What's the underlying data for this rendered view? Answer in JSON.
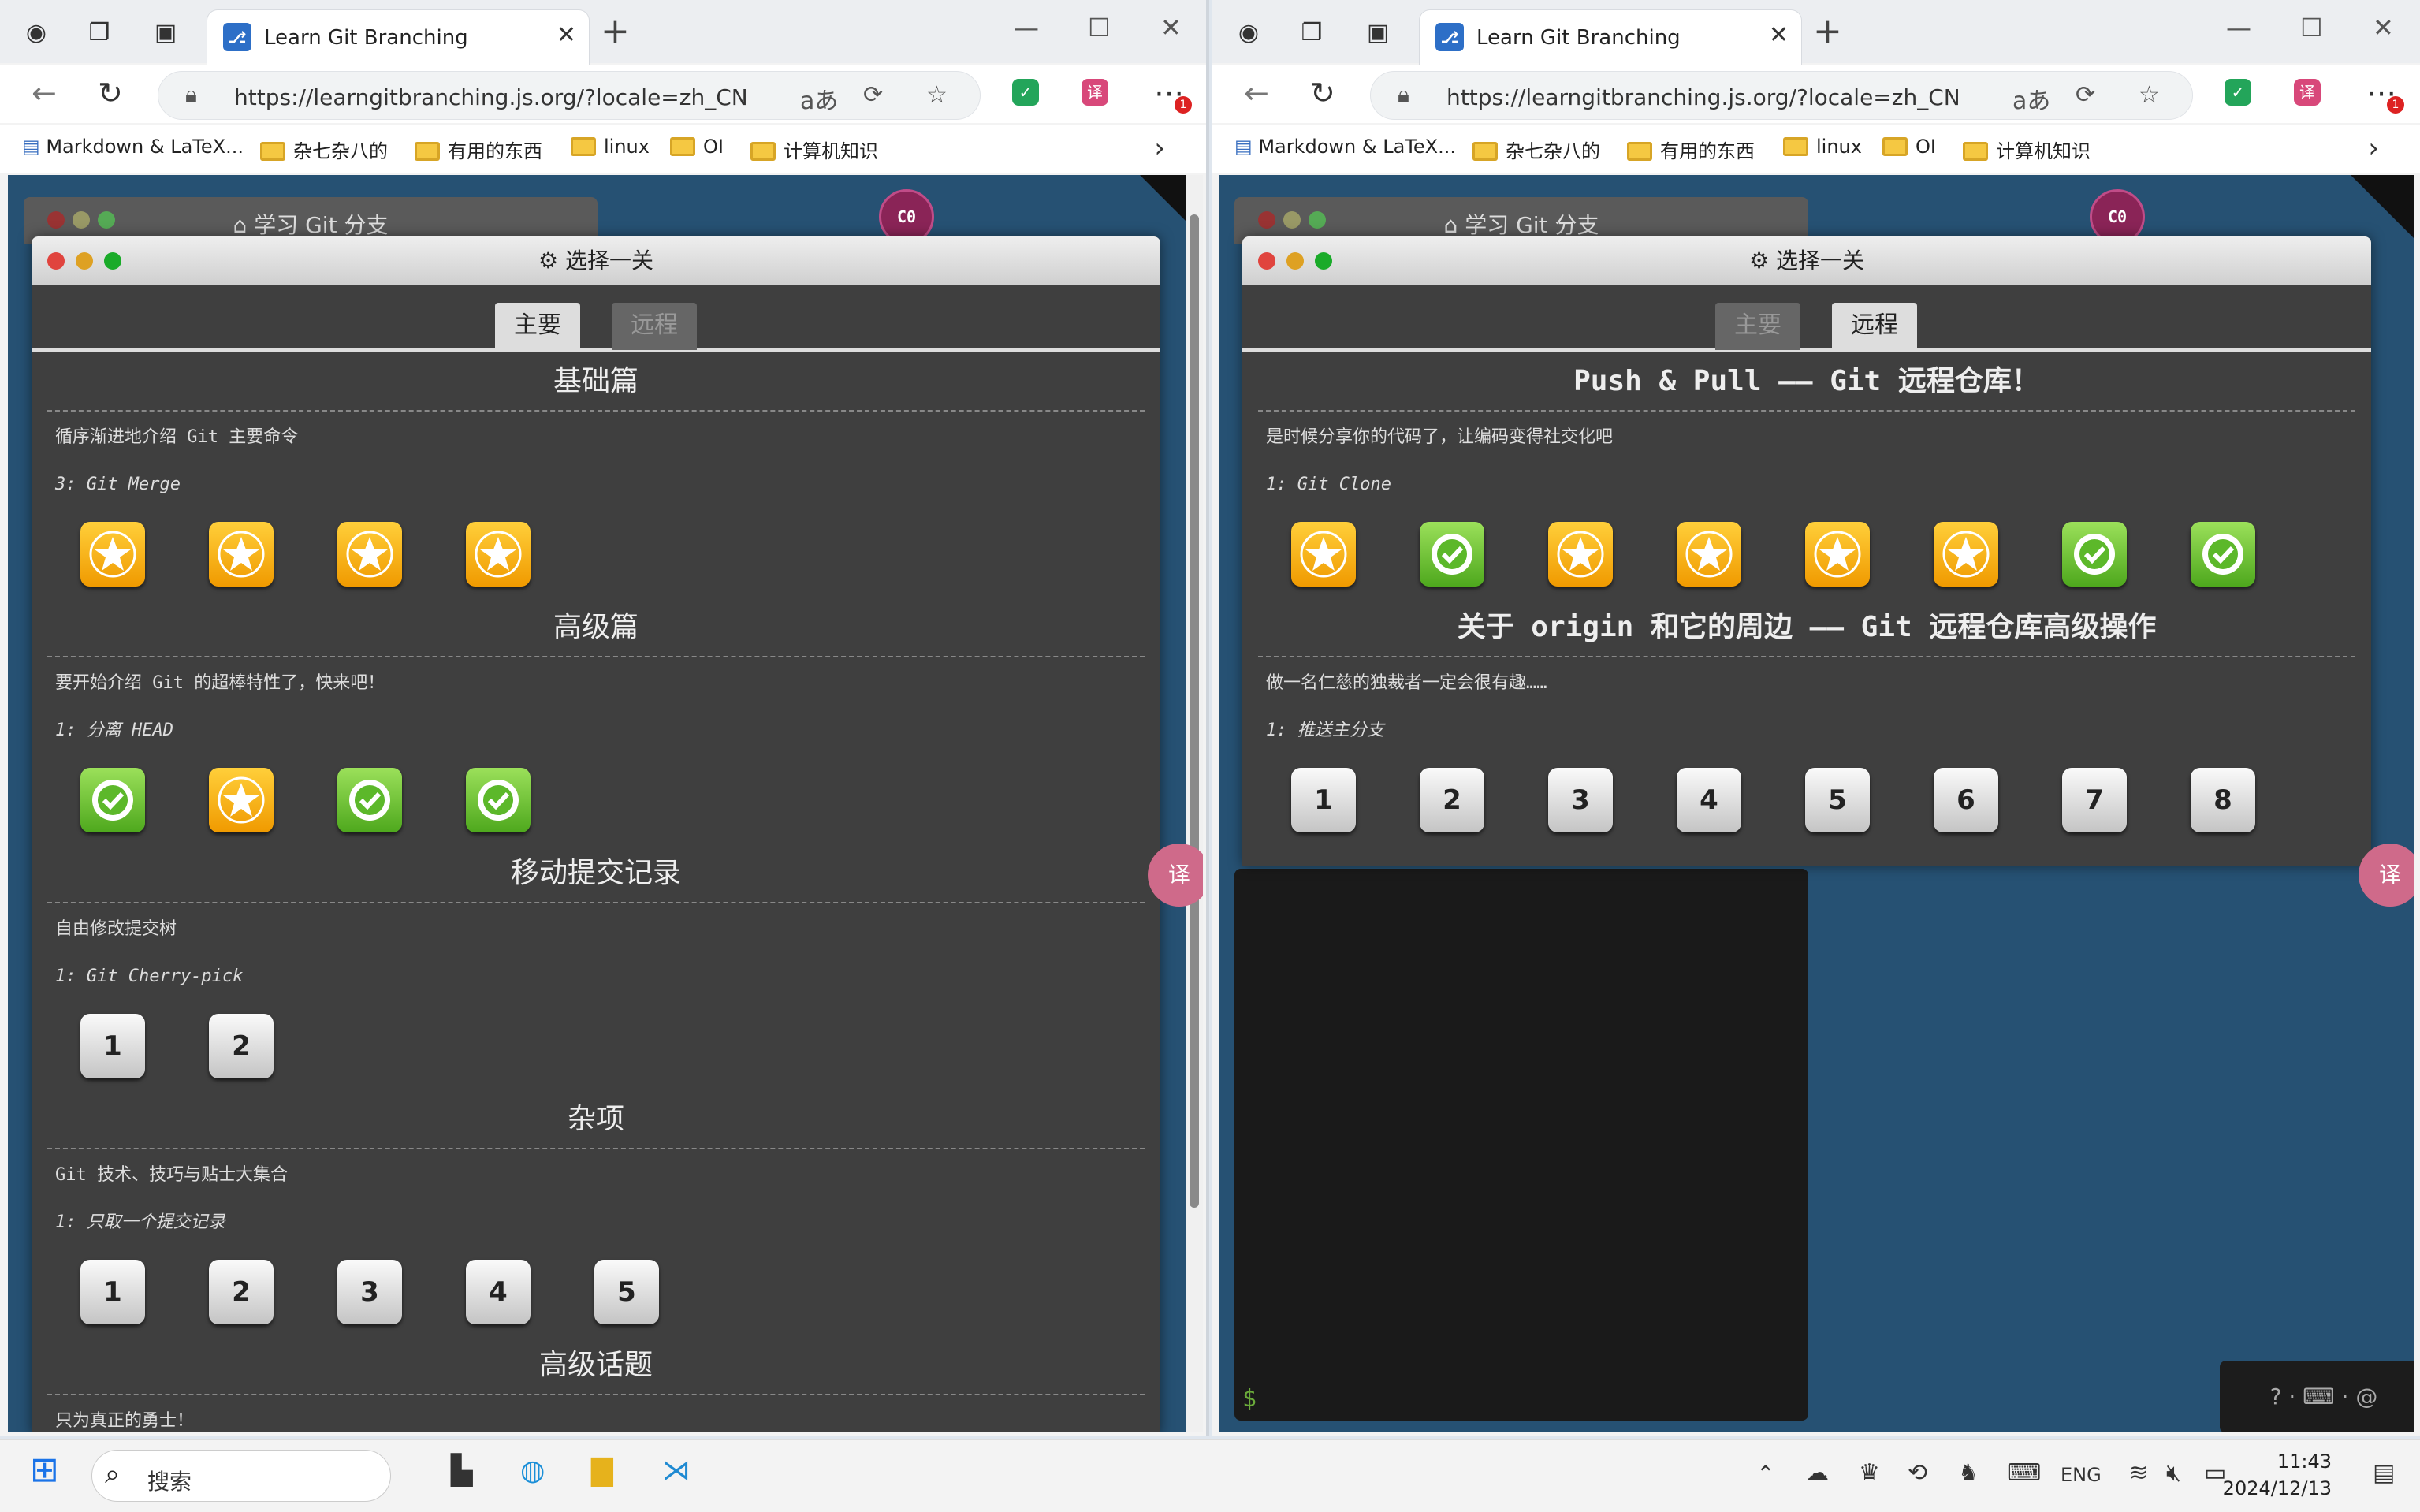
{
  "browser": {
    "tab_title": "Learn Git Branching",
    "url": "https://learngitbranching.js.org/?locale=zh_CN",
    "bookmarks": [
      "Markdown & LaTeX...",
      "杂七杂八的",
      "有用的东西",
      "linux",
      "OI",
      "计算机知识"
    ],
    "ext_badge": "1"
  },
  "app": {
    "bg_title": "学习 Git 分支",
    "dialog_title": "选择一关",
    "tab_main": "主要",
    "tab_remote": "远程",
    "head_badge": "C0",
    "prompt": "$"
  },
  "left_sections": [
    {
      "title": "基础篇",
      "desc": "循序渐进地介绍 Git 主要命令",
      "level": "3: Git Merge",
      "icons": [
        "star",
        "star",
        "star",
        "star"
      ]
    },
    {
      "title": "高级篇",
      "desc": "要开始介绍 Git 的超棒特性了，快来吧！",
      "level": "1: 分离 HEAD",
      "icons": [
        "check",
        "star",
        "check",
        "check"
      ]
    },
    {
      "title": "移动提交记录",
      "desc": "自由修改提交树",
      "level": "1: Git Cherry-pick",
      "icons": [
        "1",
        "2"
      ]
    },
    {
      "title": "杂项",
      "desc": "Git 技术、技巧与贴士大集合",
      "level": "1: 只取一个提交记录",
      "icons": [
        "1",
        "2",
        "3",
        "4",
        "5"
      ]
    },
    {
      "title": "高级话题",
      "desc": "只为真正的勇士！",
      "level": "",
      "icons": []
    }
  ],
  "right_sections": [
    {
      "title": "Push & Pull —— Git 远程仓库！",
      "desc": "是时候分享你的代码了，让编码变得社交化吧",
      "level": "1: Git Clone",
      "icons": [
        "star",
        "check",
        "star",
        "star",
        "star",
        "star",
        "check",
        "check"
      ]
    },
    {
      "title": "关于 origin 和它的周边 —— Git 远程仓库高级操作",
      "desc": "做一名仁慈的独裁者一定会很有趣……",
      "level": "1: 推送主分支",
      "icons": [
        "1",
        "2",
        "3",
        "4",
        "5",
        "6",
        "7",
        "8"
      ]
    }
  ],
  "taskbar": {
    "search_placeholder": "搜索",
    "lang": "ENG",
    "time": "11:43",
    "date": "2024/12/13"
  },
  "colors": {
    "accent_star": "#f5a300",
    "accent_check": "#5cb82a",
    "app_bg": "#265173"
  }
}
